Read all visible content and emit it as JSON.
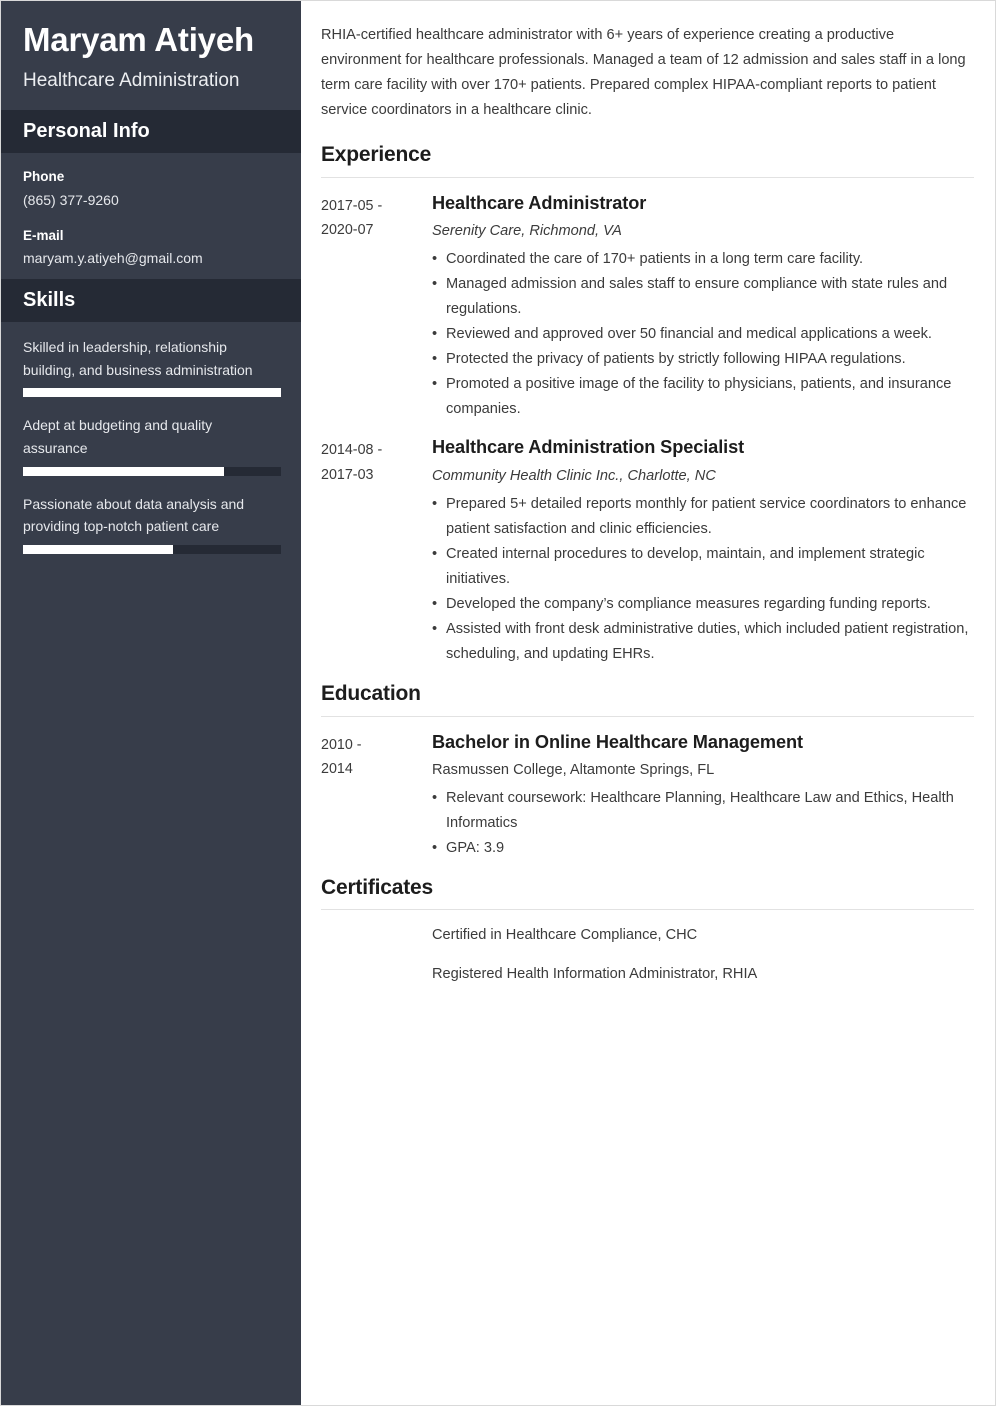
{
  "sidebar": {
    "name": "Maryam Atiyeh",
    "job_title": "Healthcare Administration",
    "personal_info": {
      "heading": "Personal Info",
      "fields": [
        {
          "label": "Phone",
          "value": "(865) 377-9260"
        },
        {
          "label": "E-mail",
          "value": "maryam.y.atiyeh@gmail.com"
        }
      ]
    },
    "skills": {
      "heading": "Skills",
      "items": [
        {
          "text": "Skilled in leadership, relationship building, and business administration",
          "level_percent": 100
        },
        {
          "text": "Adept at budgeting and quality assurance",
          "level_percent": 78
        },
        {
          "text": "Passionate about data analysis and providing top-notch patient care",
          "level_percent": 58
        }
      ]
    }
  },
  "main": {
    "summary": "RHIA-certified healthcare administrator with 6+ years of experience creating a productive environment for healthcare professionals. Managed a team of 12 admission and sales staff in a long term care facility with over 170+ patients. Prepared complex HIPAA-compliant reports to patient service coordinators in a healthcare clinic.",
    "experience": {
      "heading": "Experience",
      "entries": [
        {
          "date_start": "2017-05 -",
          "date_end": "2020-07",
          "title": "Healthcare Administrator",
          "subtitle": "Serenity Care, Richmond, VA",
          "bullets": [
            "Coordinated the care of 170+ patients in a long term care facility.",
            "Managed admission and sales staff to ensure compliance with state rules and regulations.",
            "Reviewed and approved over 50 financial and medical applications a week.",
            "Protected the privacy of patients by strictly following HIPAA regulations.",
            "Promoted a positive image of the facility to physicians, patients, and insurance companies."
          ]
        },
        {
          "date_start": "2014-08 -",
          "date_end": "2017-03",
          "title": "Healthcare Administration Specialist",
          "subtitle": "Community Health Clinic Inc., Charlotte, NC",
          "bullets": [
            "Prepared 5+ detailed reports monthly for patient service coordinators to enhance patient satisfaction and clinic efficiencies.",
            "Created internal procedures to develop, maintain, and implement strategic initiatives.",
            "Developed the company’s compliance measures regarding funding reports.",
            "Assisted with front desk administrative duties, which included patient registration, scheduling, and updating EHRs."
          ]
        }
      ]
    },
    "education": {
      "heading": "Education",
      "entries": [
        {
          "date_start": "2010 -",
          "date_end": "2014",
          "title": "Bachelor in Online Healthcare Management",
          "subtitle": "Rasmussen College, Altamonte Springs, FL",
          "bullets": [
            "Relevant coursework: Healthcare Planning, Healthcare Law and Ethics, Health Informatics",
            "GPA: 3.9"
          ]
        }
      ]
    },
    "certificates": {
      "heading": "Certificates",
      "items": [
        "Certified in Healthcare Compliance, CHC",
        "Registered Health Information Administrator, RHIA"
      ]
    }
  },
  "colors": {
    "sidebar_bg": "#373d4a",
    "sidebar_band_bg": "#252a35",
    "text_light": "#ffffff",
    "text_body": "#3b3b3b",
    "heading": "#1d1d1d",
    "rule": "#e2e2e2"
  }
}
